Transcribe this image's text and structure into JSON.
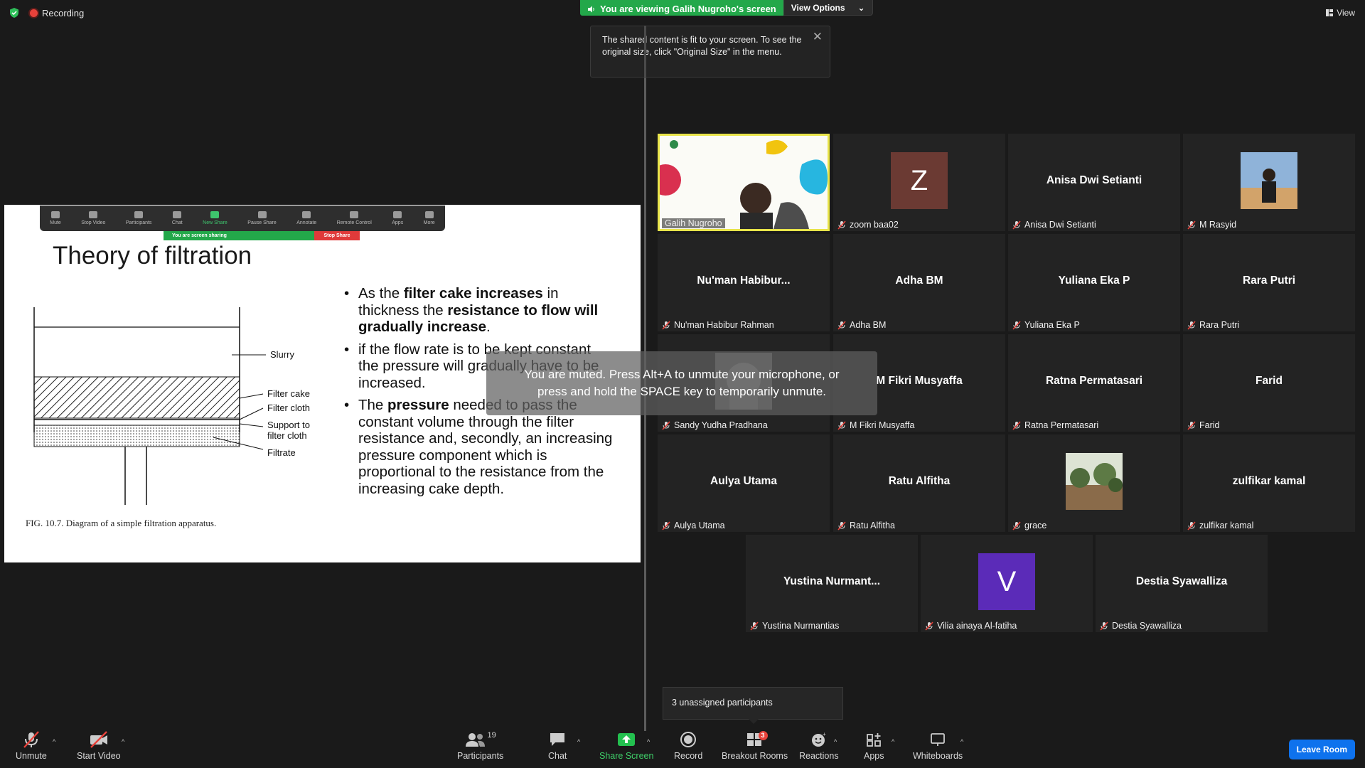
{
  "top": {
    "recording_label": "Recording",
    "viewing_text": "You are viewing Galih Nugroho's screen",
    "view_options_label": "View Options",
    "view_label": "View"
  },
  "tooltip": {
    "text": "The shared content is fit to your screen. To see the original size, click \"Original Size\" in the menu."
  },
  "slide": {
    "toolbar": [
      "Mute",
      "Stop Video",
      "Participants",
      "Chat",
      "New Share",
      "Pause Share",
      "Annotate",
      "Remote Control",
      "Apps",
      "More"
    ],
    "participants_count": "19",
    "sharing_text": "You are screen sharing",
    "stop_share": "Stop Share",
    "title": "Theory of filtration",
    "diagram_labels": {
      "slurry": "Slurry",
      "filter_cake": "Filter cake",
      "filter_cloth": "Filter cloth",
      "support_line1": "Support to",
      "support_line2": "filter cloth",
      "filtrate": "Filtrate"
    },
    "caption": "FIG. 10.7. Diagram of a simple filtration apparatus.",
    "bullet1": {
      "p1": "As the ",
      "b1": "filter cake increases",
      "p2": " in thickness the ",
      "b2": "resistance to flow will gradually increase",
      "p3": "."
    },
    "bullet2": "if the flow rate is to be kept constant the pressure will gradually have to be increased.",
    "bullet3": {
      "p1": "The ",
      "b1": "pressure",
      "p2": " needed to pass the constant volume through the filter resistance and, secondly, an increasing pressure component which is proportional to the resistance from the increasing cake depth."
    }
  },
  "toast": {
    "line1": "You are muted. Press Alt+A to unmute your microphone, or",
    "line2": "press and hold the SPACE key to temporarily unmute."
  },
  "participants": [
    {
      "label": "Galih Nugroho",
      "center": "",
      "type": "video"
    },
    {
      "label": "zoom baa02",
      "center": "",
      "type": "avatar",
      "initial": "Z",
      "color": "#6b3a33"
    },
    {
      "label": "Anisa Dwi Setianti",
      "center": "Anisa Dwi Setianti",
      "type": "name"
    },
    {
      "label": "M Rasyid",
      "center": "",
      "type": "photo"
    },
    {
      "label": "Nu'man Habibur Rahman",
      "center": "Nu'man  Habibur...",
      "type": "name"
    },
    {
      "label": "Adha BM",
      "center": "Adha BM",
      "type": "name"
    },
    {
      "label": "Yuliana Eka P",
      "center": "Yuliana Eka P",
      "type": "name"
    },
    {
      "label": "Rara Putri",
      "center": "Rara Putri",
      "type": "name"
    },
    {
      "label": "Sandy Yudha Pradhana",
      "center": "",
      "type": "photo-small"
    },
    {
      "label": "M Fikri Musyaffa",
      "center": "M Fikri Musyaffa",
      "type": "name"
    },
    {
      "label": "Ratna Permatasari",
      "center": "Ratna Permatasari",
      "type": "name"
    },
    {
      "label": "Farid",
      "center": "Farid",
      "type": "name"
    },
    {
      "label": "Aulya Utama",
      "center": "Aulya Utama",
      "type": "name"
    },
    {
      "label": "Ratu Alfitha",
      "center": "Ratu Alfitha",
      "type": "name"
    },
    {
      "label": "grace",
      "center": "",
      "type": "photo-forest"
    },
    {
      "label": "zulfikar kamal",
      "center": "zulfikar kamal",
      "type": "name"
    },
    {
      "label": "Yustina Nurmantias",
      "center": "Yustina  Nurmant...",
      "type": "name"
    },
    {
      "label": "Vilia ainaya Al-fatiha",
      "center": "",
      "type": "avatar",
      "initial": "V",
      "color": "#5b2bb8"
    },
    {
      "label": "Destia Syawalliza",
      "center": "Destia Syawalliza",
      "type": "name"
    }
  ],
  "unassigned": "3 unassigned participants",
  "toolbar": {
    "unmute": "Unmute",
    "start_video": "Start Video",
    "participants": "Participants",
    "participants_count": "19",
    "chat": "Chat",
    "share_screen": "Share Screen",
    "record": "Record",
    "breakout_rooms": "Breakout Rooms",
    "breakout_badge": "3",
    "reactions": "Reactions",
    "apps": "Apps",
    "whiteboards": "Whiteboards",
    "leave_room": "Leave Room"
  },
  "colors": {
    "green": "#23a84a",
    "red": "#e8423b",
    "blue": "#0e72ed",
    "active_border": "#e8e44a"
  }
}
